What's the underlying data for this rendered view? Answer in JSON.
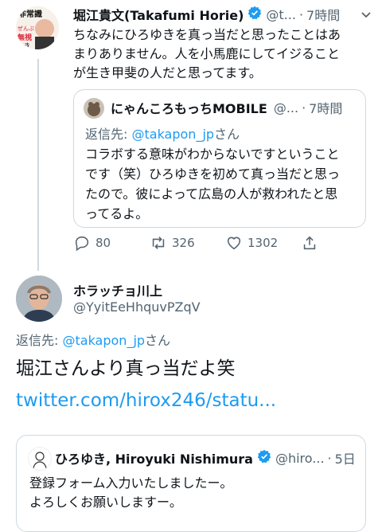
{
  "tweet1": {
    "author_name": "堀江貴文(Takafumi Horie)",
    "handle": "@t...",
    "time": "7時間",
    "text_lines": [
      "ちなみにひろゆきを真っ当だと思ったことはあ",
      "まりありません。人を小馬鹿にしてイジること",
      "が生き甲斐の人だと思ってます。"
    ],
    "quote": {
      "author_name": "にゃんころもっちMOBILE",
      "handle": "@...",
      "time": "7時間",
      "reply_prefix": "返信先: ",
      "reply_handle": "@takapon_jp",
      "reply_suffix": "さん",
      "text_lines": [
        "コラボする意味がわからないですということ",
        "です（笑）ひろゆきを初めて真っ当だと思っ",
        "たので。彼によって広島の人が救われたと思",
        "ってるよ。"
      ]
    },
    "actions": {
      "replies": "80",
      "retweets": "326",
      "likes": "1302"
    }
  },
  "tweet2": {
    "author_name": "ホラッチョ川上",
    "handle": "@YyitEeHhquvPZqV",
    "reply_prefix": "返信先: ",
    "reply_handle": "@takapon_jp",
    "reply_suffix": "さん",
    "text": "堀江さんより真っ当だよ笑",
    "link": "twitter.com/hirox246/statu...",
    "quote": {
      "author_name": "ひろゆき, Hiroyuki Nishimura",
      "handle": "@hiro...",
      "time": "5日",
      "text_lines": [
        "登録フォーム入力いたしましたー。",
        "よろしくお願いしますー。"
      ]
    }
  },
  "colors": {
    "accent": "#1d9bf0",
    "secondary_text": "#536471",
    "border": "#cfd9de"
  },
  "icons": [
    "verified-badge",
    "reply-icon",
    "retweet-icon",
    "like-icon",
    "share-icon"
  ]
}
